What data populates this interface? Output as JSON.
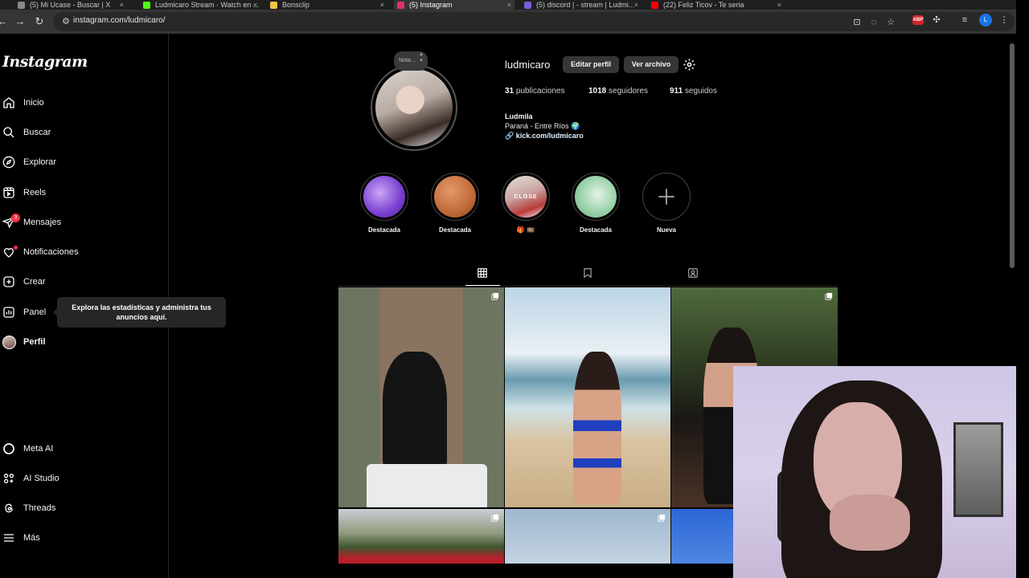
{
  "browser": {
    "tabs": [
      {
        "title": "(5) Mi Ucase - Buscar | X"
      },
      {
        "title": "Ludmicaro Stream · Watch en ..."
      },
      {
        "title": "Bonsclip"
      },
      {
        "title": "(5) Instagram",
        "active": true
      },
      {
        "title": "(5) discord | - stream | Ludmi..."
      },
      {
        "title": "(22) Feliz Ticov - Te seria"
      }
    ],
    "url": "instagram.com/ludmicaro/",
    "extension_label": "ABP",
    "profile_initial": "L"
  },
  "sidebar": {
    "logo": "Instagram",
    "items": [
      {
        "label": "Inicio",
        "icon": "home-icon"
      },
      {
        "label": "Buscar",
        "icon": "search-icon"
      },
      {
        "label": "Explorar",
        "icon": "compass-icon"
      },
      {
        "label": "Reels",
        "icon": "reels-icon"
      },
      {
        "label": "Mensajes",
        "icon": "messages-icon",
        "badge": "3"
      },
      {
        "label": "Notificaciones",
        "icon": "heart-icon",
        "dot": true
      },
      {
        "label": "Crear",
        "icon": "create-icon"
      },
      {
        "label": "Panel",
        "icon": "dashboard-icon"
      },
      {
        "label": "Perfil",
        "icon": "profile-avatar",
        "bold": true
      }
    ],
    "bottom_items": [
      {
        "label": "Meta AI",
        "icon": "meta-ai-icon"
      },
      {
        "label": "AI Studio",
        "icon": "ai-studio-icon"
      },
      {
        "label": "Threads",
        "icon": "threads-icon"
      },
      {
        "label": "Más",
        "icon": "menu-icon"
      }
    ],
    "tooltip": "Explora las estadísticas y administra tus anuncios aquí."
  },
  "profile": {
    "note": "Nota...",
    "username": "ludmicaro",
    "edit_button": "Editar perfil",
    "archive_button": "Ver archivo",
    "stats": {
      "posts_count": "31",
      "posts_label": "publicaciones",
      "followers_count": "1018",
      "followers_label": "seguidores",
      "following_count": "911",
      "following_label": "seguidos"
    },
    "bio_name": "Ludmila",
    "bio_location": "Paraná - Entre Ríos 🌍",
    "bio_link": "kick.com/ludmicaro"
  },
  "highlights": [
    {
      "name": "Destacada",
      "color": "#8a5cd6"
    },
    {
      "name": "Destacada",
      "color": "#c8743f"
    },
    {
      "name": "🎁 🎞️",
      "color": "#b83b3b",
      "cover_text": "CLOSE"
    },
    {
      "name": "Destacada",
      "color": "#8fcf9f"
    },
    {
      "name": "Nueva",
      "color": "#000000"
    }
  ],
  "colors": {
    "background": "#000000",
    "button_bg": "#363636",
    "notification_red": "#ff3040"
  }
}
